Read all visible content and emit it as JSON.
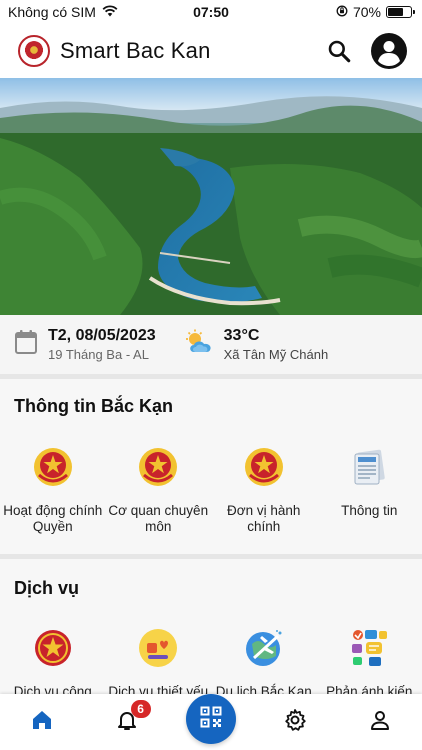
{
  "status_bar": {
    "carrier": "Không có SIM",
    "time": "07:50",
    "battery": "70%",
    "battery_level": 0.7
  },
  "header": {
    "title": "Smart Bac Kan",
    "icons": [
      "search-icon",
      "account-icon"
    ]
  },
  "info": {
    "date": "T2, 08/05/2023",
    "lunar_date": "19 Tháng Ba - AL",
    "temperature": "33°C",
    "location": "Xã Tân Mỹ Chánh"
  },
  "sections": [
    {
      "title": "Thông tin Bắc Kạn",
      "items": [
        {
          "label": "Hoạt động chính Quyền",
          "icon": "emblem-icon"
        },
        {
          "label": "Cơ quan chuyên môn",
          "icon": "emblem-icon"
        },
        {
          "label": "Đơn vị hành chính",
          "icon": "emblem-icon"
        },
        {
          "label": "Thông tin",
          "icon": "newspaper-icon"
        }
      ]
    },
    {
      "title": "Dịch vụ",
      "items": [
        {
          "label": "Dịch vụ công",
          "icon": "public-service-icon"
        },
        {
          "label": "Dịch vụ thiết yếu",
          "icon": "essential-service-icon"
        },
        {
          "label": "Du lịch Bắc Kạn",
          "icon": "tourism-icon"
        },
        {
          "label": "Phản ánh kiến nghị",
          "icon": "feedback-icon"
        }
      ]
    }
  ],
  "bottom_nav": {
    "notification_count": "6",
    "items": [
      "home-icon",
      "bell-icon",
      "qr-code-icon",
      "gear-icon",
      "profile-icon"
    ]
  },
  "colors": {
    "accent": "#1565c0",
    "badge": "#d62828",
    "emblem_red": "#c8232b",
    "emblem_gold": "#f2c230"
  }
}
